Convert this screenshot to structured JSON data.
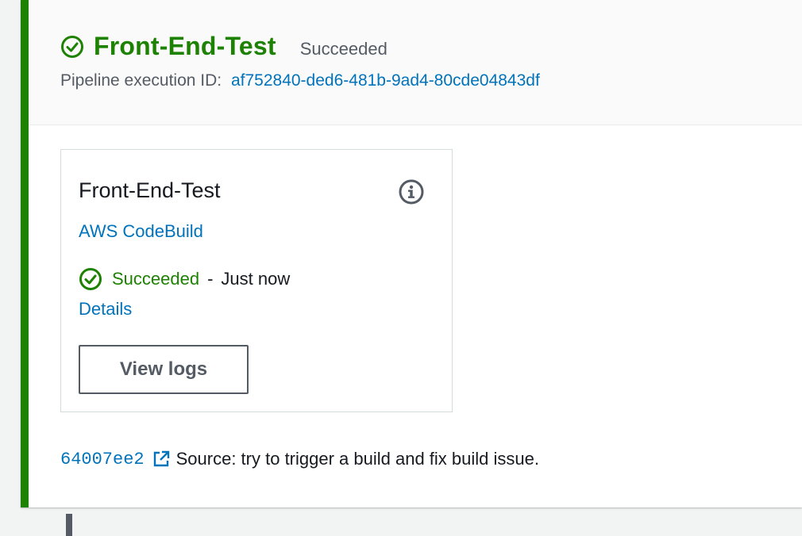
{
  "stage": {
    "name": "Front-End-Test",
    "status": "Succeeded",
    "execution_label": "Pipeline execution ID:",
    "execution_id": "af752840-ded6-481b-9ad4-80cde04843df",
    "status_icon": "check-circle-icon",
    "accent_color": "#1d8102"
  },
  "action": {
    "name": "Front-End-Test",
    "provider": "AWS CodeBuild",
    "status": "Succeeded",
    "separator": "-",
    "time": "Just now",
    "details_label": "Details",
    "view_logs_label": "View logs",
    "info_icon": "info-icon"
  },
  "source": {
    "commit_id": "64007ee2",
    "message": "Source: try to trigger a build and fix build issue.",
    "link_icon": "external-link-icon"
  },
  "colors": {
    "success": "#1d8102",
    "link": "#0073bb",
    "text": "#16191f",
    "muted": "#545b64"
  }
}
